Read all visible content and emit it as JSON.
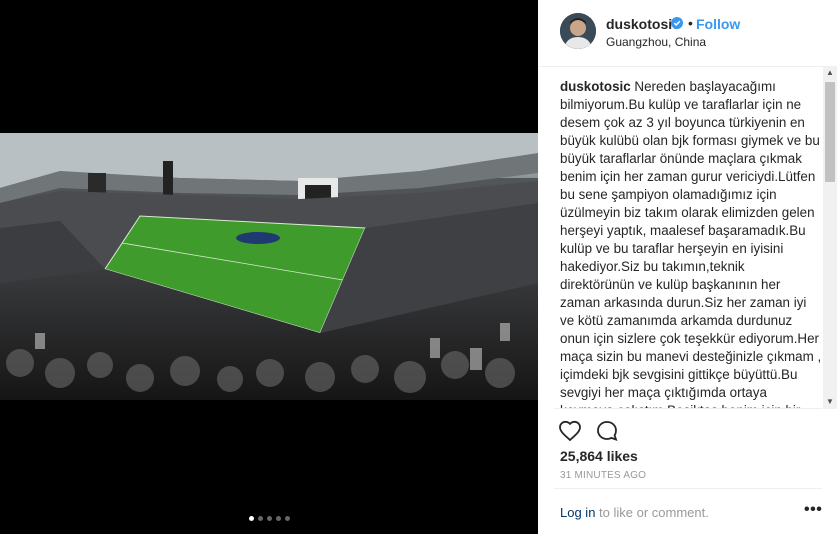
{
  "post": {
    "username": "duskotosic",
    "separator": "•",
    "follow_label": "Follow",
    "location": "Guangzhou, China",
    "caption_user": "duskotosic",
    "caption_text": "Nereden başlayacağımı bilmiyorum.Bu kulüp ve taraflarlar için ne desem çok az 3 yıl boyunca türkiyenin en büyük kulübü olan bjk forması giymek ve bu büyük taraflarlar önünde maçlara çıkmak benim için her zaman gurur vericiydi.Lütfen bu sene şampiyon olamadığımız için üzülmeyin biz takım olarak elimizden gelen herşeyi yaptık, maalesef başaramadık.Bu kulüp ve bu taraflar herşeyin en iyisini hakediyor.Siz bu takımın,teknik direktörünün ve kulüp başkanının her zaman arkasında durun.Siz her zaman iyi ve kötü zamanımda arkamda durdunuz onun için sizlere çok teşekkür ediyorum.Her maça sizin bu manevi desteğinizle çıkmam , içimdeki bjk sevgisini gittikçe büyüttü.Bu sevgiyi her maça çıktığımda ortaya koymaya çalıştım.Beşiktaş benim için bir aile gibi oldu gidiyorum lakin uzaktada olsam",
    "likes": "25,864 likes",
    "time": "31 MINUTES AGO",
    "login_link": "Log in",
    "login_text": " to like or comment.",
    "more_label": "•••"
  },
  "carousel": {
    "count": 5,
    "active": 0
  },
  "icons": {
    "like": "heart-outline-icon",
    "comment": "comment-bubble-icon",
    "verified": "verified-badge-icon",
    "more": "more-options-icon"
  },
  "colors": {
    "link": "#3897f0",
    "verified": "#3897f0",
    "text": "#262626",
    "muted": "#999999",
    "pitch": "#3f9b2c"
  }
}
